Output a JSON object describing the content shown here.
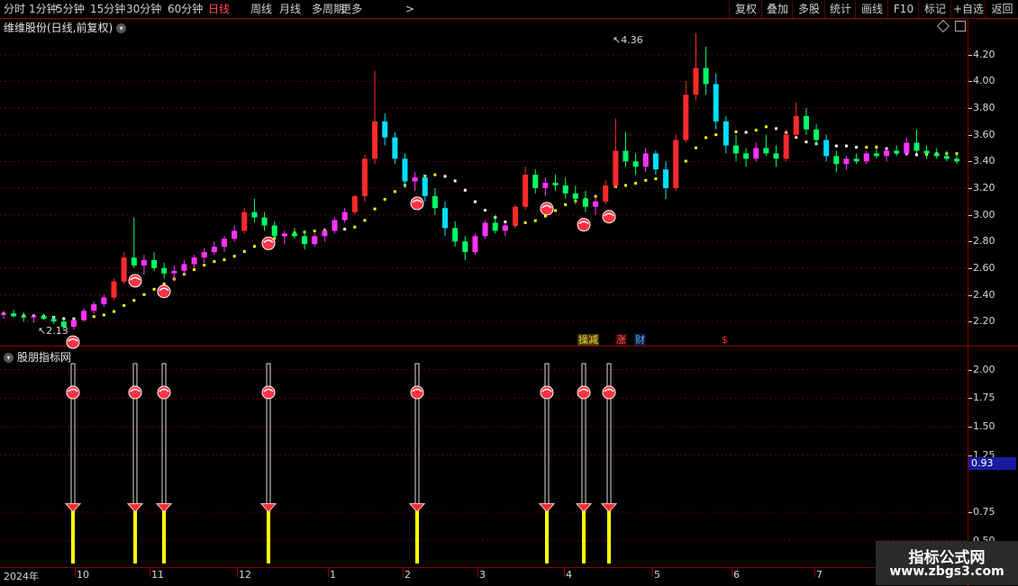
{
  "toolbar": {
    "periods": [
      "分时",
      "1分钟",
      "5分钟",
      "15分钟",
      "30分钟",
      "60分钟",
      "日线",
      "周线",
      "月线",
      "多周期",
      "更多"
    ],
    "active_period": "日线",
    "more_arrow": ">",
    "right_buttons": [
      "复权",
      "叠加",
      "多股",
      "统计",
      "画线",
      "F10",
      "标记",
      "+自选",
      "返回"
    ]
  },
  "main_panel": {
    "title": "维维股份(日线,前复权)",
    "y_ticks": [
      "4.20",
      "4.00",
      "3.80",
      "3.60",
      "3.40",
      "3.20",
      "3.00",
      "2.80",
      "2.60",
      "2.40",
      "2.20"
    ],
    "high_label": "4.36",
    "low_label": "2.13",
    "badges": {
      "b1": "操减",
      "b2": "涨",
      "b3": "财",
      "b4": "$"
    }
  },
  "sub_panel": {
    "title": "股朋指标网",
    "y_ticks": [
      "2.00",
      "1.75",
      "1.50",
      "1.25",
      "0.75",
      "0.50"
    ],
    "current_value": "0.93"
  },
  "x_axis": {
    "labels": [
      "2024年",
      "10",
      "11",
      "12",
      "1",
      "2",
      "3",
      "4",
      "5",
      "6",
      "7"
    ]
  },
  "watermark": {
    "line1": "指标公式网",
    "line2": "www.zbgs3.com"
  },
  "colors": {
    "up": "#ff2a2a",
    "down": "#00e0ff",
    "ma_up": "#ffff00",
    "ma_down": "#ffffff",
    "grid": "#8b0000",
    "purple": "#ff33ff",
    "green": "#00ff66"
  },
  "chart_data": {
    "type": "candlestick",
    "ylim": [
      2.1,
      4.34
    ],
    "signal_y": [
      1.8,
      0.8
    ],
    "sub_ylim": [
      0.3,
      2.1
    ],
    "signal_positions": [
      81,
      150,
      182,
      298,
      463,
      607,
      648,
      676
    ],
    "candles": [
      [
        2.25,
        2.28,
        2.22,
        2.26
      ],
      [
        2.26,
        2.29,
        2.23,
        2.24
      ],
      [
        2.24,
        2.27,
        2.2,
        2.23
      ],
      [
        2.23,
        2.25,
        2.19,
        2.24
      ],
      [
        2.24,
        2.26,
        2.21,
        2.22
      ],
      [
        2.22,
        2.24,
        2.18,
        2.2
      ],
      [
        2.2,
        2.22,
        2.13,
        2.16
      ],
      [
        2.16,
        2.22,
        2.14,
        2.21
      ],
      [
        2.21,
        2.3,
        2.2,
        2.28
      ],
      [
        2.28,
        2.35,
        2.26,
        2.33
      ],
      [
        2.33,
        2.4,
        2.31,
        2.38
      ],
      [
        2.38,
        2.52,
        2.36,
        2.5
      ],
      [
        2.5,
        2.72,
        2.48,
        2.68
      ],
      [
        2.68,
        2.98,
        2.6,
        2.62
      ],
      [
        2.62,
        2.7,
        2.55,
        2.66
      ],
      [
        2.66,
        2.72,
        2.58,
        2.6
      ],
      [
        2.6,
        2.64,
        2.52,
        2.56
      ],
      [
        2.56,
        2.62,
        2.5,
        2.58
      ],
      [
        2.58,
        2.66,
        2.55,
        2.63
      ],
      [
        2.63,
        2.7,
        2.6,
        2.68
      ],
      [
        2.68,
        2.75,
        2.64,
        2.72
      ],
      [
        2.72,
        2.8,
        2.7,
        2.76
      ],
      [
        2.76,
        2.84,
        2.72,
        2.82
      ],
      [
        2.82,
        2.92,
        2.8,
        2.88
      ],
      [
        2.88,
        3.05,
        2.86,
        3.02
      ],
      [
        3.02,
        3.12,
        2.94,
        2.98
      ],
      [
        2.98,
        3.02,
        2.88,
        2.92
      ],
      [
        2.92,
        2.95,
        2.8,
        2.84
      ],
      [
        2.84,
        2.88,
        2.78,
        2.86
      ],
      [
        2.86,
        2.9,
        2.82,
        2.84
      ],
      [
        2.84,
        2.88,
        2.74,
        2.78
      ],
      [
        2.78,
        2.86,
        2.76,
        2.84
      ],
      [
        2.84,
        2.9,
        2.8,
        2.88
      ],
      [
        2.88,
        2.98,
        2.86,
        2.96
      ],
      [
        2.96,
        3.05,
        2.94,
        3.02
      ],
      [
        3.02,
        3.15,
        3.0,
        3.14
      ],
      [
        3.14,
        3.45,
        3.1,
        3.42
      ],
      [
        3.42,
        4.08,
        3.38,
        3.7
      ],
      [
        3.7,
        3.76,
        3.52,
        3.58
      ],
      [
        3.58,
        3.62,
        3.38,
        3.42
      ],
      [
        3.42,
        3.46,
        3.2,
        3.25
      ],
      [
        3.25,
        3.32,
        3.18,
        3.28
      ],
      [
        3.28,
        3.3,
        3.1,
        3.14
      ],
      [
        3.14,
        3.2,
        3.0,
        3.05
      ],
      [
        3.05,
        3.1,
        2.84,
        2.9
      ],
      [
        2.9,
        2.95,
        2.76,
        2.8
      ],
      [
        2.8,
        2.84,
        2.66,
        2.72
      ],
      [
        2.72,
        2.86,
        2.7,
        2.84
      ],
      [
        2.84,
        2.96,
        2.82,
        2.94
      ],
      [
        2.94,
        3.0,
        2.86,
        2.88
      ],
      [
        2.88,
        2.94,
        2.84,
        2.92
      ],
      [
        2.92,
        3.08,
        2.9,
        3.06
      ],
      [
        3.06,
        3.36,
        3.04,
        3.3
      ],
      [
        3.3,
        3.34,
        3.16,
        3.2
      ],
      [
        3.2,
        3.28,
        3.14,
        3.24
      ],
      [
        3.24,
        3.3,
        3.18,
        3.22
      ],
      [
        3.22,
        3.28,
        3.12,
        3.16
      ],
      [
        3.16,
        3.22,
        3.08,
        3.12
      ],
      [
        3.12,
        3.18,
        3.02,
        3.06
      ],
      [
        3.06,
        3.14,
        3.0,
        3.1
      ],
      [
        3.1,
        3.26,
        3.08,
        3.22
      ],
      [
        3.22,
        3.72,
        3.2,
        3.48
      ],
      [
        3.48,
        3.62,
        3.36,
        3.4
      ],
      [
        3.4,
        3.46,
        3.3,
        3.36
      ],
      [
        3.36,
        3.5,
        3.32,
        3.46
      ],
      [
        3.46,
        3.48,
        3.3,
        3.34
      ],
      [
        3.34,
        3.4,
        3.12,
        3.2
      ],
      [
        3.2,
        3.6,
        3.18,
        3.56
      ],
      [
        3.56,
        4.0,
        3.54,
        3.9
      ],
      [
        3.9,
        4.36,
        3.86,
        4.1
      ],
      [
        4.1,
        4.26,
        3.9,
        3.98
      ],
      [
        3.98,
        4.06,
        3.64,
        3.7
      ],
      [
        3.7,
        3.74,
        3.46,
        3.52
      ],
      [
        3.52,
        3.6,
        3.4,
        3.46
      ],
      [
        3.46,
        3.5,
        3.36,
        3.42
      ],
      [
        3.42,
        3.54,
        3.4,
        3.5
      ],
      [
        3.5,
        3.6,
        3.44,
        3.46
      ],
      [
        3.46,
        3.52,
        3.36,
        3.42
      ],
      [
        3.42,
        3.64,
        3.4,
        3.6
      ],
      [
        3.6,
        3.84,
        3.58,
        3.74
      ],
      [
        3.74,
        3.8,
        3.6,
        3.64
      ],
      [
        3.64,
        3.68,
        3.52,
        3.56
      ],
      [
        3.56,
        3.6,
        3.4,
        3.44
      ],
      [
        3.44,
        3.48,
        3.32,
        3.38
      ],
      [
        3.38,
        3.44,
        3.34,
        3.42
      ],
      [
        3.42,
        3.46,
        3.38,
        3.4
      ],
      [
        3.4,
        3.48,
        3.38,
        3.46
      ],
      [
        3.46,
        3.5,
        3.42,
        3.44
      ],
      [
        3.44,
        3.5,
        3.4,
        3.48
      ],
      [
        3.48,
        3.52,
        3.44,
        3.46
      ],
      [
        3.46,
        3.58,
        3.44,
        3.54
      ],
      [
        3.54,
        3.64,
        3.46,
        3.48
      ],
      [
        3.48,
        3.52,
        3.42,
        3.46
      ],
      [
        3.46,
        3.5,
        3.42,
        3.44
      ],
      [
        3.44,
        3.48,
        3.4,
        3.42
      ],
      [
        3.42,
        3.46,
        3.38,
        3.4
      ]
    ]
  }
}
